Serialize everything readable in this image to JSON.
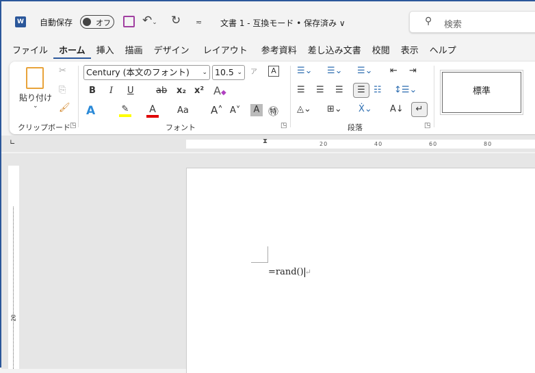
{
  "titlebar": {
    "app_icon": "W",
    "autosave_label": "自動保存",
    "autosave_state": "オフ",
    "document_title": "文書 1  -  互換モード • 保存済み ∨",
    "search_placeholder": "検索"
  },
  "tabs": [
    {
      "label": "ファイル"
    },
    {
      "label": "ホーム",
      "active": true
    },
    {
      "label": "挿入"
    },
    {
      "label": "描画"
    },
    {
      "label": "デザイン"
    },
    {
      "label": "レイアウト"
    },
    {
      "label": "参考資料"
    },
    {
      "label": "差し込み文書"
    },
    {
      "label": "校閲"
    },
    {
      "label": "表示"
    },
    {
      "label": "ヘルプ"
    }
  ],
  "ribbon": {
    "clipboard": {
      "paste_label": "貼り付け",
      "group_label": "クリップボード"
    },
    "font": {
      "font_name": "Century (本文のフォント)",
      "font_size": "10.5",
      "group_label": "フォント",
      "bold": "B",
      "italic": "I",
      "underline": "U",
      "strike": "ab",
      "subscript": "x₂",
      "superscript": "x²",
      "text_effect": "A",
      "highlight_color": "#ffff00",
      "font_color": "#e00000",
      "font_color_glyph": "A",
      "change_case": "Aa",
      "grow": "A˄",
      "shrink": "A˅",
      "shading": "A",
      "enclose": "㊕"
    },
    "paragraph": {
      "group_label": "段落"
    },
    "styles": {
      "normal_label": "標準"
    }
  },
  "ruler": {
    "labels": [
      "20",
      "40",
      "60",
      "80"
    ],
    "vertical_label": "20"
  },
  "document": {
    "text": "=rand()",
    "para_mark": "↵"
  }
}
